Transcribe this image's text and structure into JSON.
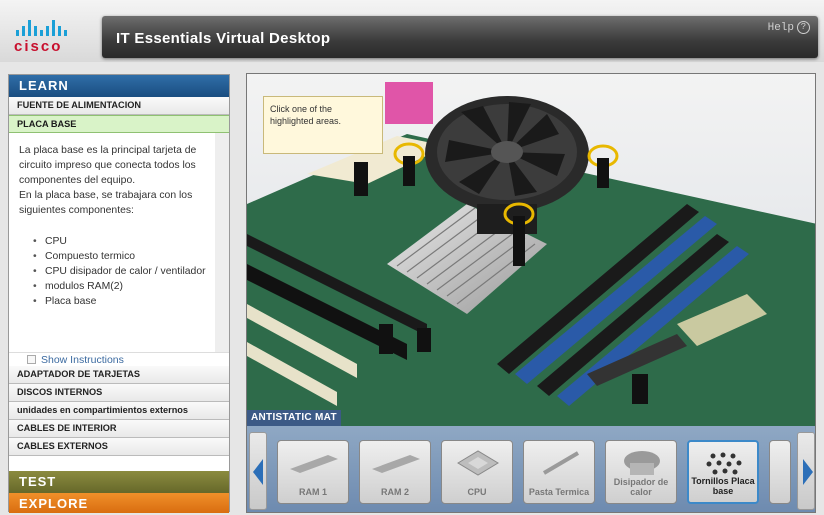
{
  "header": {
    "logo_text": "cisco",
    "title": "IT Essentials Virtual Desktop",
    "help_label": "Help",
    "help_icon": "?"
  },
  "sidebar": {
    "learn_label": "LEARN",
    "items_top": [
      {
        "label": "FUENTE DE ALIMENTACION"
      },
      {
        "label": "PLACA BASE",
        "active": true
      }
    ],
    "content": {
      "paragraph1": "La placa base es la principal tarjeta de circuito impreso que conecta todos los componentes del equipo.",
      "paragraph2": "En la placa base, se trabajara con los siguientes componentes:",
      "bullets": [
        "CPU",
        "Compuesto termico",
        "CPU disipador de calor / ventilador",
        "modulos RAM(2)",
        "Placa base"
      ]
    },
    "show_instructions": "Show Instructions",
    "items_bottom": [
      {
        "label": "ADAPTADOR DE TARJETAS"
      },
      {
        "label": "DISCOS INTERNOS"
      },
      {
        "label": "unidades en compartimientos externos"
      },
      {
        "label": "CABLES DE INTERIOR"
      },
      {
        "label": "CABLES EXTERNOS"
      }
    ],
    "test_label": "TEST",
    "explore_label": "EXPLORE"
  },
  "stage": {
    "tooltip": "Click one of the highlighted areas.",
    "mat_label": "ANTISTATIC MAT",
    "tray_items": [
      {
        "label": "RAM 1",
        "icon": "ram-module-icon"
      },
      {
        "label": "RAM 2",
        "icon": "ram-module-icon"
      },
      {
        "label": "CPU",
        "icon": "cpu-chip-icon"
      },
      {
        "label": "Pasta Termica",
        "icon": "thermal-paste-icon"
      },
      {
        "label": "Disipador de calor",
        "icon": "heatsink-fan-icon"
      },
      {
        "label": "Tornillos Placa base",
        "icon": "screws-icon",
        "selected": true
      }
    ]
  },
  "colors": {
    "learn": "#1a4d80",
    "test": "#66682a",
    "explore": "#d96d10",
    "active_item": "#d9f3c8",
    "board_green": "#2e6b4a"
  }
}
